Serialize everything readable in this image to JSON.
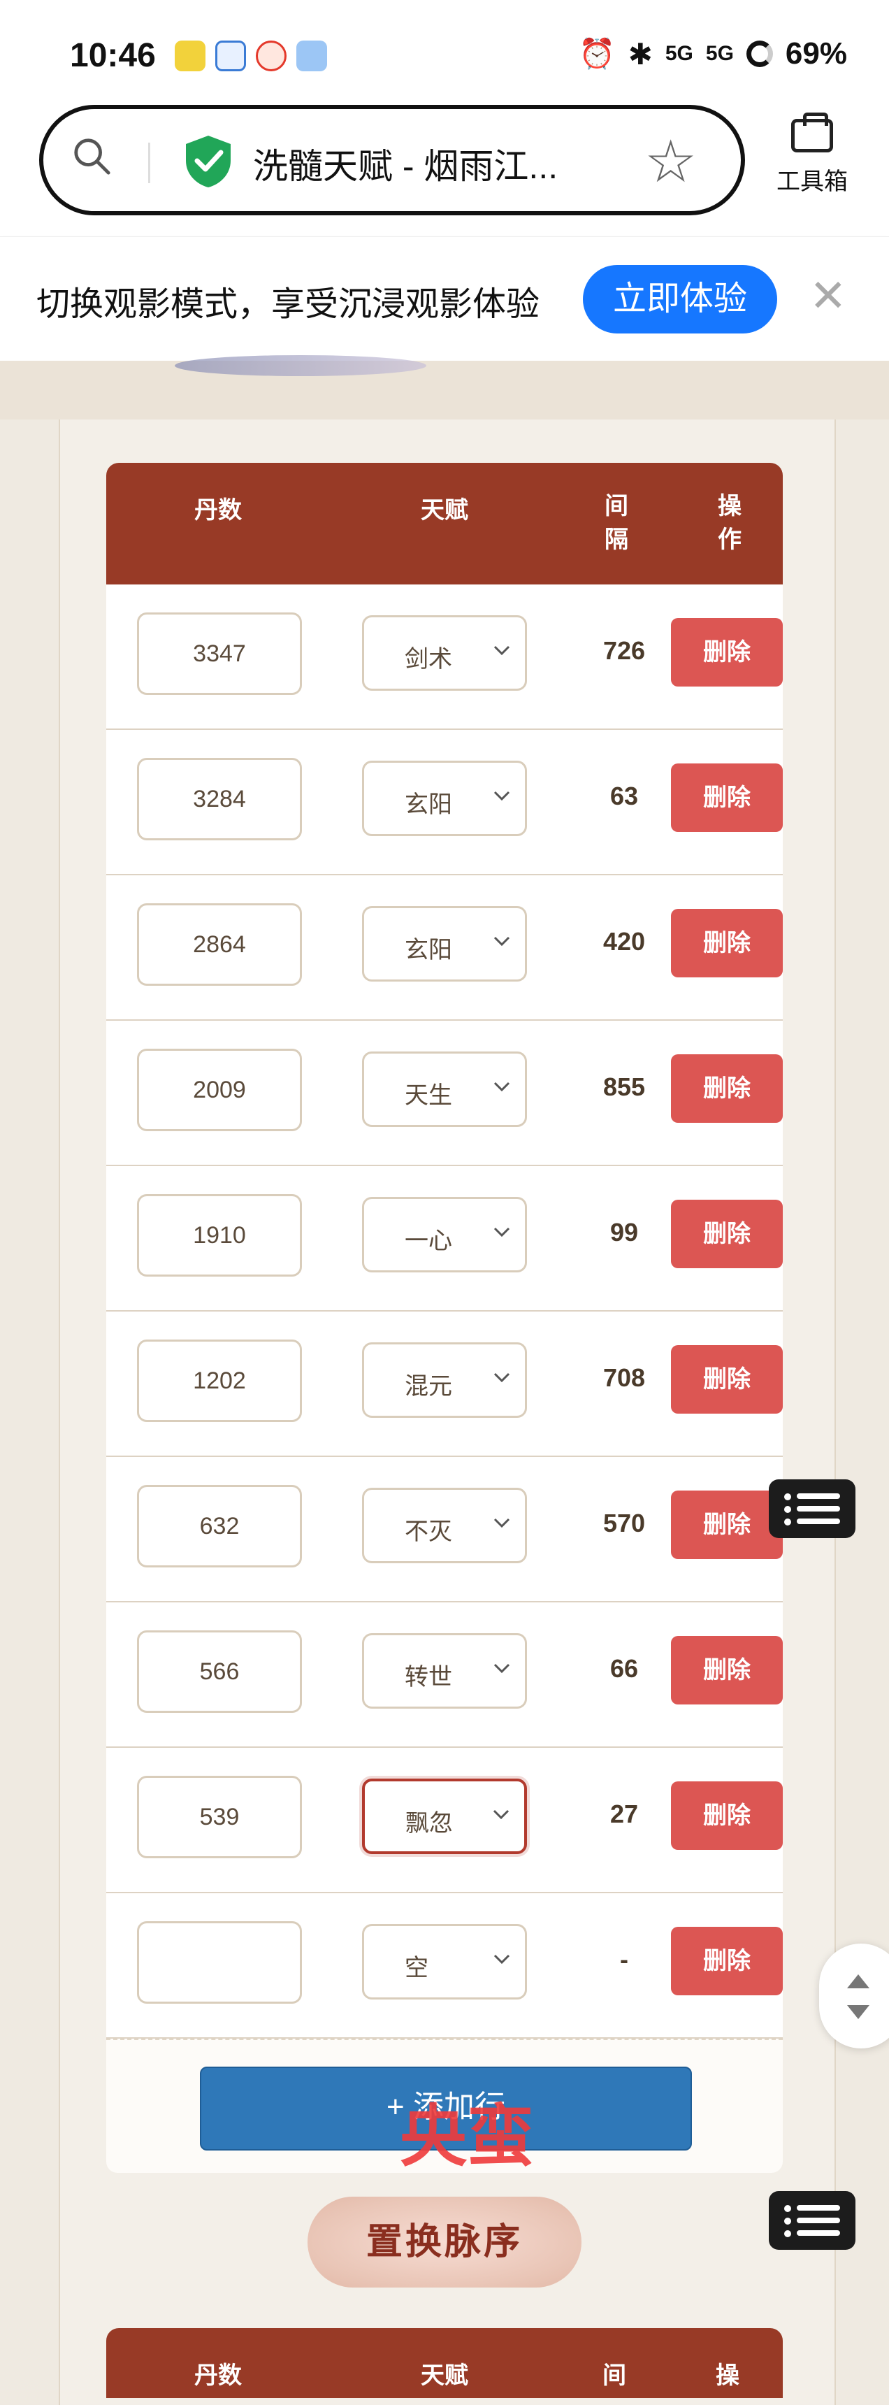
{
  "status_bar": {
    "time": "10:46",
    "battery": "69%",
    "network_labels": [
      "5G",
      "5G"
    ]
  },
  "browser": {
    "page_title": "洗髓天赋 - 烟雨江...",
    "toolbox_label": "工具箱"
  },
  "promo": {
    "text": "切换观影模式，享受沉浸观影体验",
    "button": "立即体验"
  },
  "table": {
    "headers": {
      "dan": "丹数",
      "talent": "天赋",
      "gap": "间隔",
      "op": "操作"
    },
    "rows": [
      {
        "dan": "3347",
        "talent": "剑术",
        "gap": "726",
        "delete": "删除"
      },
      {
        "dan": "3284",
        "talent": "玄阳",
        "gap": "63",
        "delete": "删除"
      },
      {
        "dan": "2864",
        "talent": "玄阳",
        "gap": "420",
        "delete": "删除"
      },
      {
        "dan": "2009",
        "talent": "天生",
        "gap": "855",
        "delete": "删除"
      },
      {
        "dan": "1910",
        "talent": "一心",
        "gap": "99",
        "delete": "删除"
      },
      {
        "dan": "1202",
        "talent": "混元",
        "gap": "708",
        "delete": "删除"
      },
      {
        "dan": "632",
        "talent": "不灭",
        "gap": "570",
        "delete": "删除"
      },
      {
        "dan": "566",
        "talent": "转世",
        "gap": "66",
        "delete": "删除"
      },
      {
        "dan": "539",
        "talent": "飘忽",
        "gap": "27",
        "delete": "删除"
      },
      {
        "dan": "",
        "talent": "空",
        "gap": "-",
        "delete": "删除"
      }
    ],
    "add_row": "+ 添加行",
    "watermark": "央蛮"
  },
  "section2": {
    "title": "置换脉序",
    "headers": {
      "dan": "丹数",
      "talent": "天赋",
      "gap": "间",
      "op": "操"
    }
  },
  "colors": {
    "header": "#983a26",
    "delete": "#dc5653",
    "add": "#2f78b8",
    "accent": "#1677ff"
  }
}
